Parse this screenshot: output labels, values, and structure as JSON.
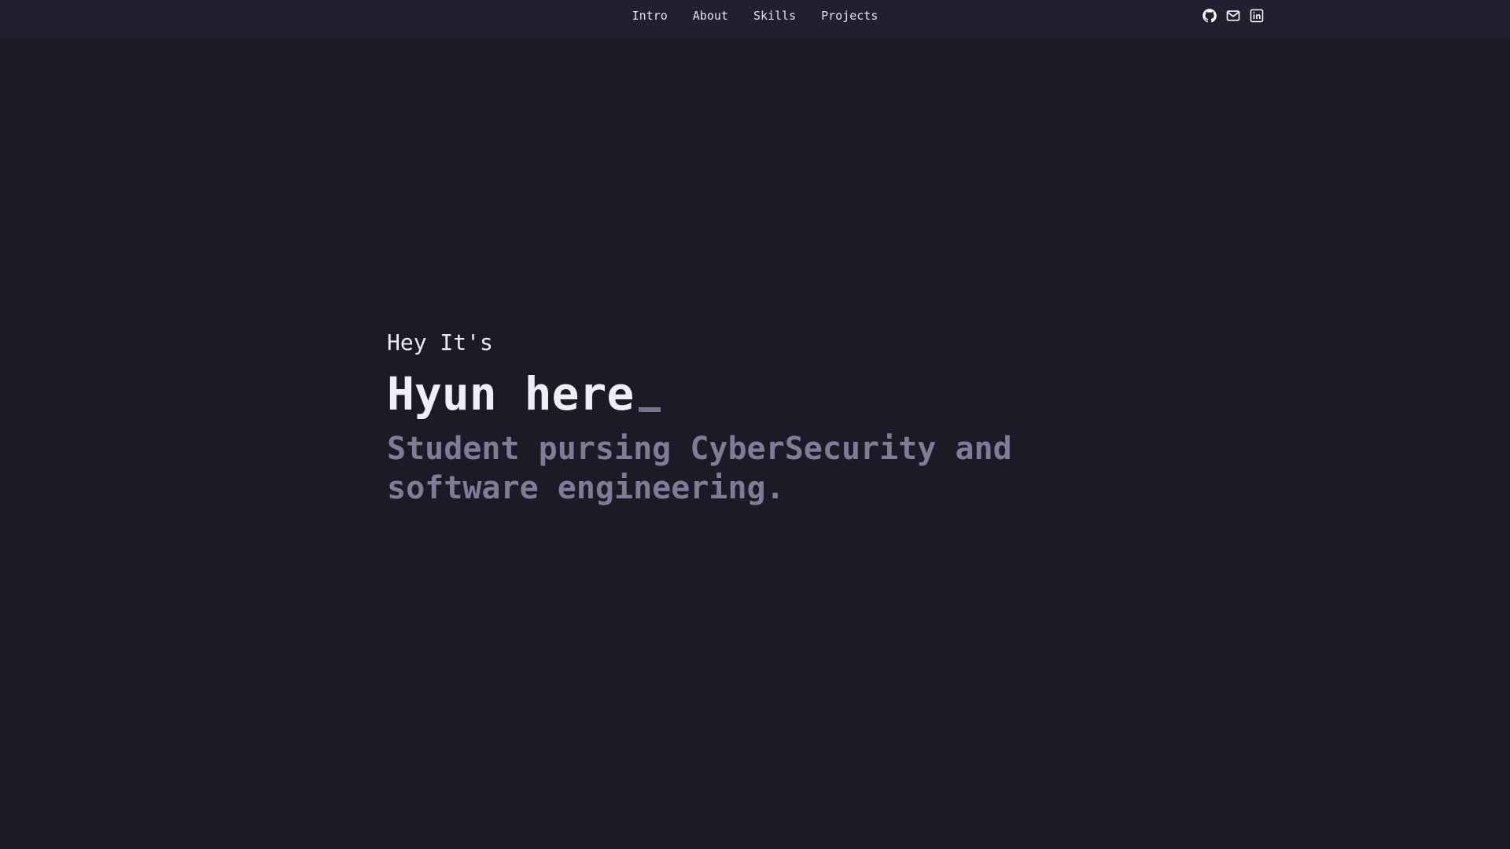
{
  "nav": {
    "items": [
      {
        "label": "Intro"
      },
      {
        "label": "About"
      },
      {
        "label": "Skills"
      },
      {
        "label": "Projects"
      }
    ]
  },
  "socials": [
    {
      "icon": "github-icon"
    },
    {
      "icon": "mail-icon"
    },
    {
      "icon": "linkedin-icon"
    }
  ],
  "hero": {
    "greeting": "Hey It's",
    "name": "Hyun here",
    "tagline": "Student pursing CyberSecurity and software engineering."
  },
  "colors": {
    "background": "#1b1a27",
    "header": "#212030",
    "text_primary": "#efedf9",
    "text_muted": "#807c98"
  }
}
